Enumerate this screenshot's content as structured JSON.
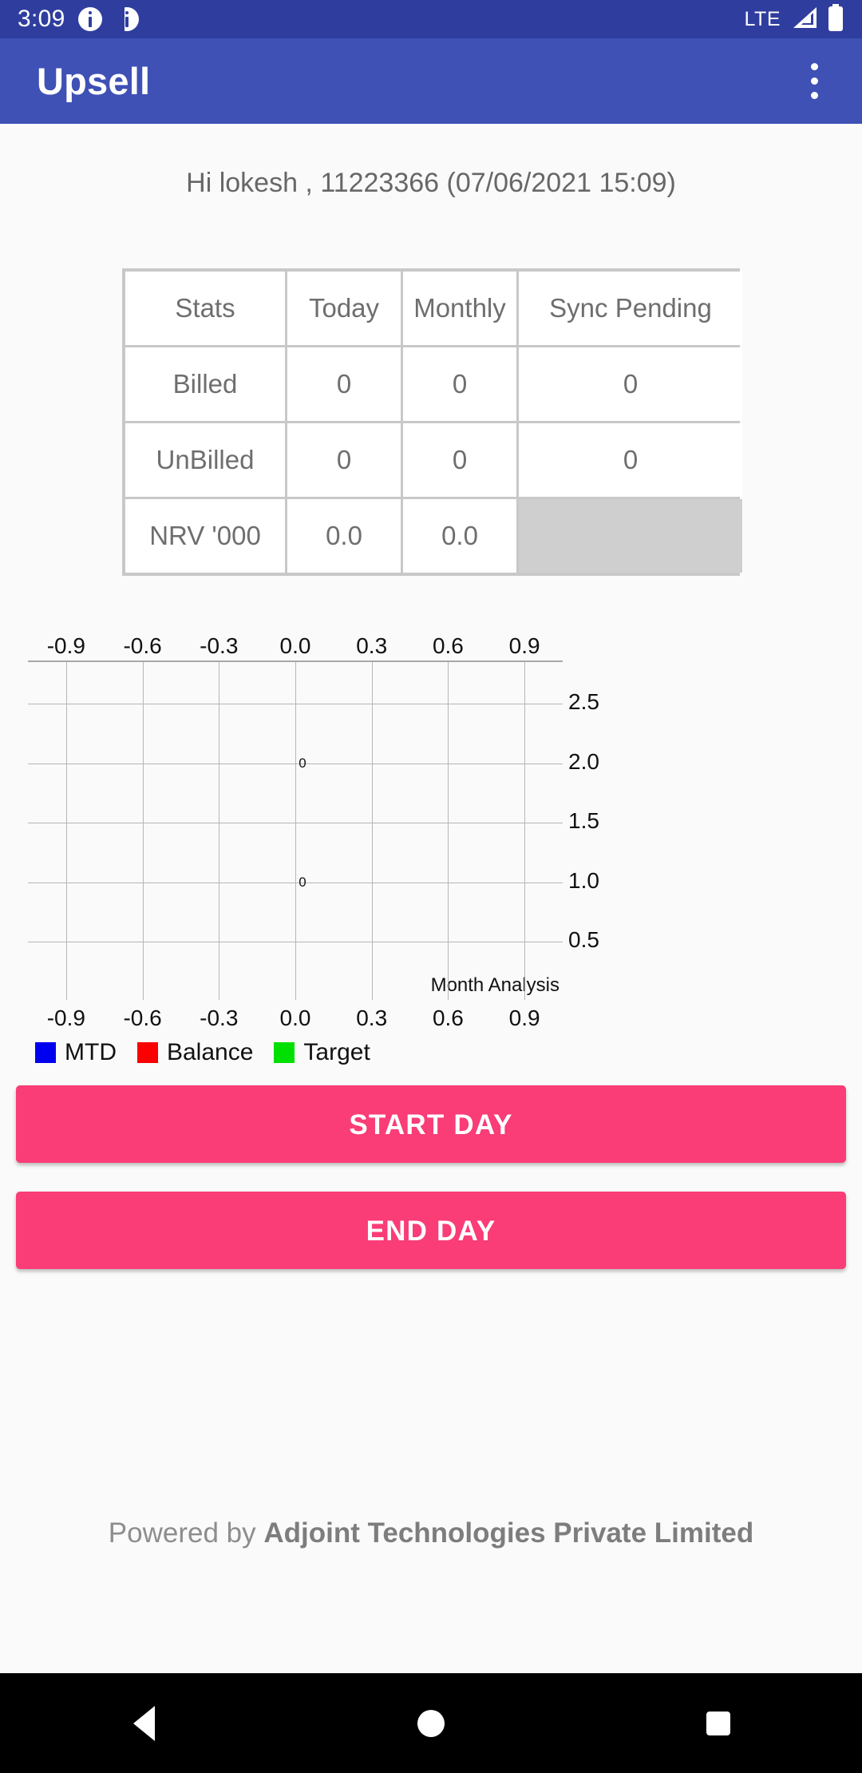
{
  "status_bar": {
    "clock": "3:09",
    "network": "LTE",
    "icons": [
      "info-circle-icon",
      "info-circle-half-icon",
      "signal-icon",
      "battery-icon"
    ]
  },
  "app_bar": {
    "title": "Upsell",
    "overflow_icon": "more-vertical-icon"
  },
  "greeting": "Hi lokesh , 11223366 (07/06/2021 15:09)",
  "stats_table": {
    "headers": [
      "Stats",
      "Today",
      "Monthly",
      "Sync Pending"
    ],
    "rows": [
      {
        "label": "Billed",
        "today": "0",
        "monthly": "0",
        "sync_pending": "0"
      },
      {
        "label": "UnBilled",
        "today": "0",
        "monthly": "0",
        "sync_pending": "0"
      },
      {
        "label": "NRV '000",
        "today": "0.0",
        "monthly": "0.0",
        "sync_pending": ""
      }
    ]
  },
  "chart_data": {
    "type": "bar",
    "title": "",
    "annotation": "Month Analysis",
    "xlabel": "",
    "ylabel": "",
    "x_ticks_top": [
      "-0.9",
      "-0.6",
      "-0.3",
      "0.0",
      "0.3",
      "0.6",
      "0.9"
    ],
    "x_ticks_bottom": [
      "-0.9",
      "-0.6",
      "-0.3",
      "0.0",
      "0.3",
      "0.6",
      "0.9"
    ],
    "y_ticks": [
      "2.5",
      "2.0",
      "1.5",
      "1.0",
      "0.5"
    ],
    "xlim": [
      -1.05,
      1.05
    ],
    "ylim": [
      0.0,
      2.85
    ],
    "grid": true,
    "legend_position": "bottom-left",
    "series": [
      {
        "name": "MTD",
        "color": "#0000f0",
        "values": [
          0
        ]
      },
      {
        "name": "Balance",
        "color": "#fa0000",
        "values": [
          0
        ]
      },
      {
        "name": "Target",
        "color": "#00e000",
        "values": [
          0
        ]
      }
    ],
    "point_labels": [
      {
        "x": 0.0,
        "y": 2.0,
        "text": "0"
      },
      {
        "x": 0.0,
        "y": 1.0,
        "text": "0"
      }
    ]
  },
  "buttons": {
    "start_day": "START DAY",
    "end_day": "END DAY"
  },
  "footer": {
    "prefix": "Powered by ",
    "company": "Adjoint Technologies Private Limited"
  },
  "nav_bar": {
    "back": "back-triangle-icon",
    "home": "home-circle-icon",
    "recents": "recents-square-icon"
  }
}
